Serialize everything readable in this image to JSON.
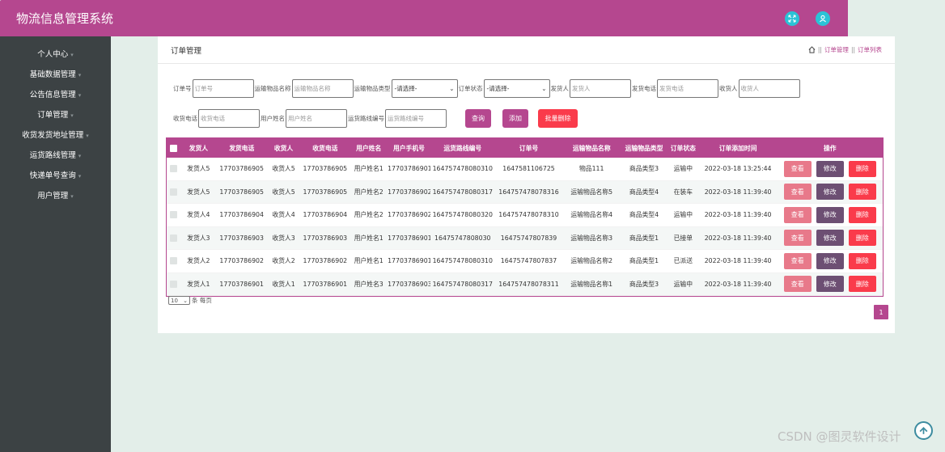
{
  "app": {
    "title": "物流信息管理系统"
  },
  "top_icons": [
    "fullscreen-icon",
    "user-icon"
  ],
  "sidebar": {
    "items": [
      {
        "label": "个人中心"
      },
      {
        "label": "基础数据管理"
      },
      {
        "label": "公告信息管理"
      },
      {
        "label": "订单管理"
      },
      {
        "label": "收货发货地址管理"
      },
      {
        "label": "运货路线管理"
      },
      {
        "label": "快递单号查询"
      },
      {
        "label": "用户管理"
      }
    ]
  },
  "panel": {
    "title": "订单管理",
    "breadcrumb": {
      "sep": "||",
      "level1": "订单管理",
      "level2": "订单列表"
    }
  },
  "filters": {
    "order_no": {
      "label": "订单号",
      "placeholder": "订单号"
    },
    "goods_name": {
      "label": "运输物品名称",
      "placeholder": "运输物品名称"
    },
    "goods_type": {
      "label": "运输物品类型",
      "value": "-请选择-"
    },
    "order_status": {
      "label": "订单状态",
      "value": "-请选择-"
    },
    "sender": {
      "label": "发货人",
      "placeholder": "发货人"
    },
    "sender_phone": {
      "label": "发货电话",
      "placeholder": "发货电话"
    },
    "receiver": {
      "label": "收货人",
      "placeholder": "收货人"
    },
    "receiver_phone": {
      "label": "收货电话",
      "placeholder": "收货电话"
    },
    "user_name": {
      "label": "用户姓名",
      "placeholder": "用户姓名"
    },
    "route_no": {
      "label": "运货路线编号",
      "placeholder": "运货路线编号"
    },
    "buttons": {
      "search": "查询",
      "add": "添加",
      "batch_delete": "批量删除"
    }
  },
  "colors": {
    "accent": "#b5478f",
    "view": "#e8798a",
    "edit": "#6d4f73",
    "delete": "#fa3b4b",
    "sidebar": "#3c4244",
    "icon": "#2bc3d6"
  },
  "table": {
    "headers": [
      "发货人",
      "发货电话",
      "收货人",
      "收货电话",
      "用户姓名",
      "用户手机号",
      "运货路线编号",
      "订单号",
      "运输物品名称",
      "运输物品类型",
      "订单状态",
      "订单添加时间",
      "操作"
    ],
    "rows": [
      [
        "发货人5",
        "17703786905",
        "收货人5",
        "17703786905",
        "用户姓名1",
        "17703786901",
        "164757478080310",
        "1647581106725",
        "物品111",
        "商品类型3",
        "运输中",
        "2022-03-18 13:25:44"
      ],
      [
        "发货人5",
        "17703786905",
        "收货人5",
        "17703786905",
        "用户姓名2",
        "17703786902",
        "164757478080317",
        "164757478078316",
        "运输物品名称5",
        "商品类型4",
        "在装车",
        "2022-03-18 11:39:40"
      ],
      [
        "发货人4",
        "17703786904",
        "收货人4",
        "17703786904",
        "用户姓名2",
        "17703786902",
        "164757478080320",
        "164757478078310",
        "运输物品名称4",
        "商品类型4",
        "运输中",
        "2022-03-18 11:39:40"
      ],
      [
        "发货人3",
        "17703786903",
        "收货人3",
        "17703786903",
        "用户姓名1",
        "17703786901",
        "16475747808030",
        "16475747807839",
        "运输物品名称3",
        "商品类型1",
        "已接单",
        "2022-03-18 11:39:40"
      ],
      [
        "发货人2",
        "17703786902",
        "收货人2",
        "17703786902",
        "用户姓名1",
        "17703786901",
        "164757478080310",
        "16475747807837",
        "运输物品名称2",
        "商品类型1",
        "已派送",
        "2022-03-18 11:39:40"
      ],
      [
        "发货人1",
        "17703786901",
        "收货人1",
        "17703786901",
        "用户姓名3",
        "17703786903",
        "164757478080317",
        "164757478078311",
        "运输物品名称1",
        "商品类型3",
        "运输中",
        "2022-03-18 11:39:40"
      ]
    ],
    "row_actions": {
      "view": "查看",
      "edit": "修改",
      "delete": "删除"
    }
  },
  "pagination": {
    "page_size": "10",
    "per_page_label": "条 每页",
    "current_page": "1"
  },
  "watermark": "CSDN @图灵软件设计"
}
